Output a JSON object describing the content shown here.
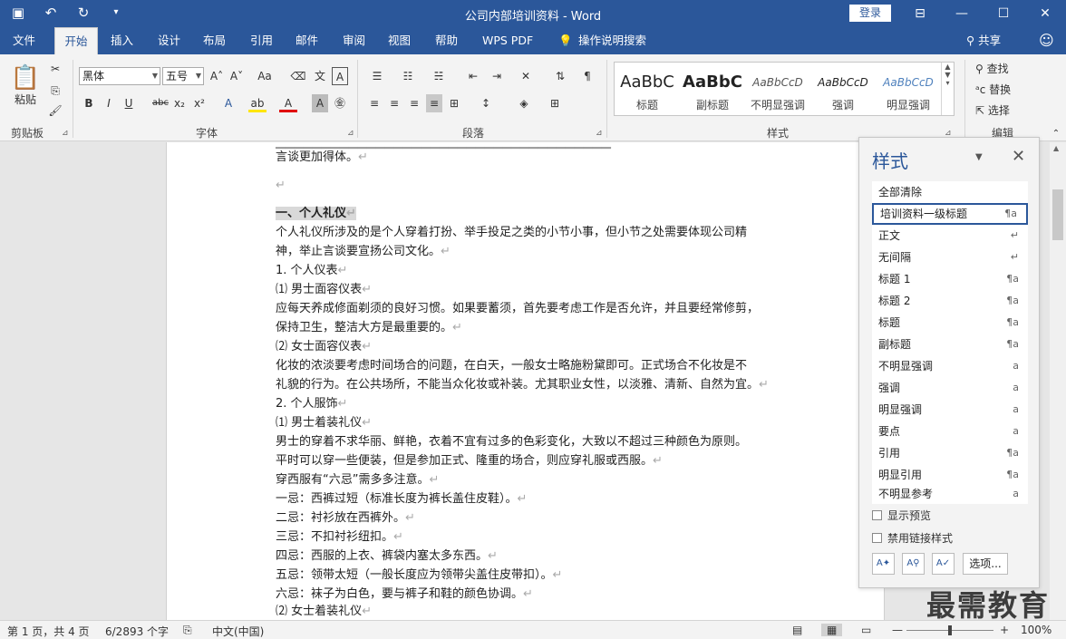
{
  "window": {
    "title": "公司内部培训资料  -  Word",
    "login": "登录"
  },
  "tabs": [
    "文件",
    "开始",
    "插入",
    "设计",
    "布局",
    "引用",
    "邮件",
    "审阅",
    "视图",
    "帮助",
    "WPS PDF",
    "操作说明搜索"
  ],
  "share": "共享",
  "ribbon": {
    "clipboard": {
      "label": "剪贴板",
      "paste": "粘贴"
    },
    "font": {
      "label": "字体",
      "name": "黑体",
      "size": "五号"
    },
    "paragraph": {
      "label": "段落"
    },
    "styles": {
      "label": "样式",
      "gallery": [
        {
          "preview": "AaBbC",
          "name": "标题"
        },
        {
          "preview": "AaBbC",
          "name": "副标题"
        },
        {
          "preview": "AaBbCcD",
          "name": "不明显强调"
        },
        {
          "preview": "AaBbCcD",
          "name": "强调"
        },
        {
          "preview": "AaBbCcD",
          "name": "明显强调"
        }
      ]
    },
    "editing": {
      "label": "编辑",
      "find": "查找",
      "replace": "替换",
      "select": "选择"
    }
  },
  "document": {
    "lines": [
      "言谈更加得体。",
      "",
      "一、个人礼仪",
      "个人礼仪所涉及的是个人穿着打扮、举手投足之类的小节小事，但小节之处需要体现公司精",
      "神，举止言谈要宣扬公司文化。",
      "1. 个人仪表",
      "⑴ 男士面容仪表",
      "应每天养成修面剃须的良好习惯。如果要蓄须，首先要考虑工作是否允许，并且要经常修剪，",
      "保持卫生，整洁大方是最重要的。",
      "⑵ 女士面容仪表",
      "化妆的浓淡要考虑时间场合的问题，在白天，一般女士略施粉黛即可。正式场合不化妆是不",
      "礼貌的行为。在公共场所，不能当众化妆或补装。尤其职业女性，以淡雅、清新、自然为宜。",
      "2. 个人服饰",
      "⑴ 男士着装礼仪",
      "男士的穿着不求华丽、鲜艳，衣着不宜有过多的色彩变化，大致以不超过三种颜色为原则。",
      "平时可以穿一些便装，但是参加正式、隆重的场合，则应穿礼服或西服。",
      "穿西服有“六忌”需多多注意。",
      "一忌：西裤过短（标准长度为裤长盖住皮鞋）。",
      "二忌：衬衫放在西裤外。",
      "三忌：不扣衬衫纽扣。",
      "四忌：西服的上衣、裤袋内塞太多东西。",
      "五忌：领带太短（一般长度应为领带尖盖住皮带扣）。",
      "六忌：袜子为白色，要与裤子和鞋的颜色协调。",
      "⑵ 女士着装礼仪"
    ]
  },
  "styles_pane": {
    "title": "样式",
    "items": [
      {
        "name": "全部清除",
        "mark": ""
      },
      {
        "name": "培训资料一级标题",
        "mark": "¶a"
      },
      {
        "name": "正文",
        "mark": "↵"
      },
      {
        "name": "无间隔",
        "mark": "↵"
      },
      {
        "name": "标题 1",
        "mark": "¶a"
      },
      {
        "name": "标题 2",
        "mark": "¶a"
      },
      {
        "name": "标题",
        "mark": "¶a"
      },
      {
        "name": "副标题",
        "mark": "¶a"
      },
      {
        "name": "不明显强调",
        "mark": "a"
      },
      {
        "name": "强调",
        "mark": "a"
      },
      {
        "name": "明显强调",
        "mark": "a"
      },
      {
        "name": "要点",
        "mark": "a"
      },
      {
        "name": "引用",
        "mark": "¶a"
      },
      {
        "name": "明显引用",
        "mark": "¶a"
      },
      {
        "name": "不明显参考",
        "mark": "a"
      }
    ],
    "show_preview": "显示预览",
    "disable_linked": "禁用链接样式",
    "options": "选项..."
  },
  "status": {
    "page": "第 1 页，共 4 页",
    "words": "6/2893 个字",
    "lang": "中文(中国)",
    "zoom": "100%"
  },
  "watermark": "最需教育"
}
